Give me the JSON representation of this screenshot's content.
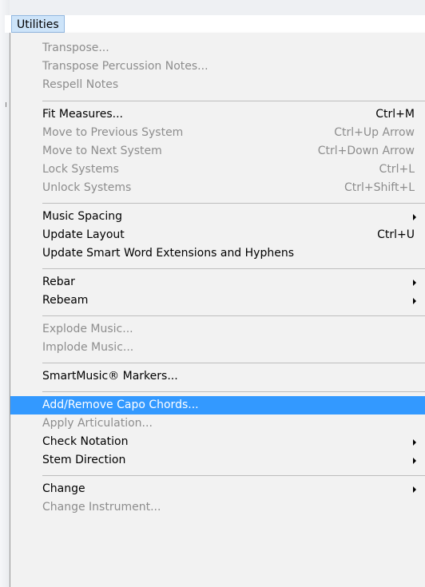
{
  "menubar": {
    "title": "Utilities"
  },
  "menu": {
    "items": [
      {
        "label": "Transpose...",
        "shortcut": "",
        "enabled": false
      },
      {
        "label": "Transpose Percussion Notes...",
        "shortcut": "",
        "enabled": false
      },
      {
        "label": "Respell Notes",
        "shortcut": "",
        "enabled": false
      },
      {
        "label": "Fit Measures...",
        "shortcut": "Ctrl+M",
        "enabled": true
      },
      {
        "label": "Move to Previous System",
        "shortcut": "Ctrl+Up Arrow",
        "enabled": false
      },
      {
        "label": "Move to Next System",
        "shortcut": "Ctrl+Down Arrow",
        "enabled": false
      },
      {
        "label": "Lock Systems",
        "shortcut": "Ctrl+L",
        "enabled": false
      },
      {
        "label": "Unlock Systems",
        "shortcut": "Ctrl+Shift+L",
        "enabled": false
      },
      {
        "label": "Music Spacing",
        "shortcut": "",
        "enabled": true,
        "submenu": true
      },
      {
        "label": "Update Layout",
        "shortcut": "Ctrl+U",
        "enabled": true
      },
      {
        "label": "Update Smart Word Extensions and Hyphens",
        "shortcut": "",
        "enabled": true
      },
      {
        "label": "Rebar",
        "shortcut": "",
        "enabled": true,
        "submenu": true
      },
      {
        "label": "Rebeam",
        "shortcut": "",
        "enabled": true,
        "submenu": true
      },
      {
        "label": "Explode Music...",
        "shortcut": "",
        "enabled": false
      },
      {
        "label": "Implode Music...",
        "shortcut": "",
        "enabled": false
      },
      {
        "label": "SmartMusic® Markers...",
        "shortcut": "",
        "enabled": true
      },
      {
        "label": "Add/Remove Capo Chords...",
        "shortcut": "",
        "enabled": true,
        "highlighted": true
      },
      {
        "label": "Apply Articulation...",
        "shortcut": "",
        "enabled": false
      },
      {
        "label": "Check Notation",
        "shortcut": "",
        "enabled": true,
        "submenu": true
      },
      {
        "label": "Stem Direction",
        "shortcut": "",
        "enabled": true,
        "submenu": true
      },
      {
        "label": "Change",
        "shortcut": "",
        "enabled": true,
        "submenu": true
      },
      {
        "label": "Change Instrument...",
        "shortcut": "",
        "enabled": false
      }
    ]
  },
  "colors": {
    "highlight": "#3399ff",
    "disabled_text": "#8d8d8d",
    "menu_bg": "#f2f2f2"
  }
}
